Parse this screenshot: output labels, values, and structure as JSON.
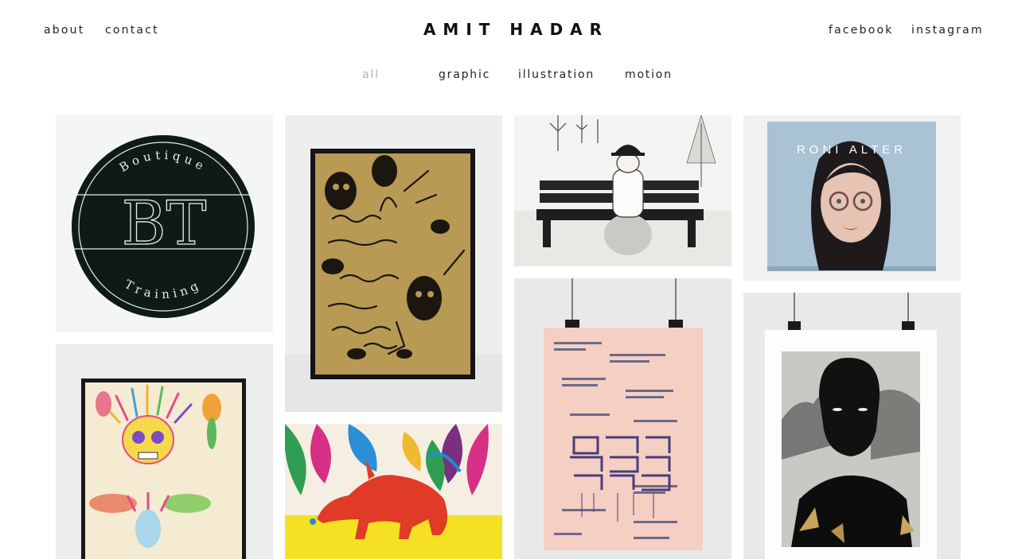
{
  "header": {
    "title": "AMIT HADAR",
    "left_links": [
      {
        "label": "about"
      },
      {
        "label": "contact"
      }
    ],
    "right_links": [
      {
        "label": "facebook"
      },
      {
        "label": "instagram"
      }
    ]
  },
  "filters": {
    "items": [
      {
        "label": "all",
        "active": true
      },
      {
        "label": "graphic",
        "active": false
      },
      {
        "label": "illustration",
        "active": false
      },
      {
        "label": "motion",
        "active": false
      }
    ]
  },
  "portfolio": {
    "items": [
      {
        "name": "boutique-training-logo",
        "logo_top": "Boutique",
        "logo_mark": "BT",
        "logo_bottom": "Training"
      },
      {
        "name": "hebrew-illustrated-poster"
      },
      {
        "name": "woman-on-bench-illustration"
      },
      {
        "name": "roni-alter-album-cover",
        "cover_text": "RONI ALTER"
      },
      {
        "name": "colorful-skull-poster"
      },
      {
        "name": "aardvark-jungle-illustration"
      },
      {
        "name": "pink-hebrew-typographic-poster"
      },
      {
        "name": "black-figure-portrait-poster"
      }
    ]
  },
  "colors": {
    "active_filter": "#b3b3b3",
    "text": "#222222",
    "logo_dark": "#0d1a17"
  }
}
